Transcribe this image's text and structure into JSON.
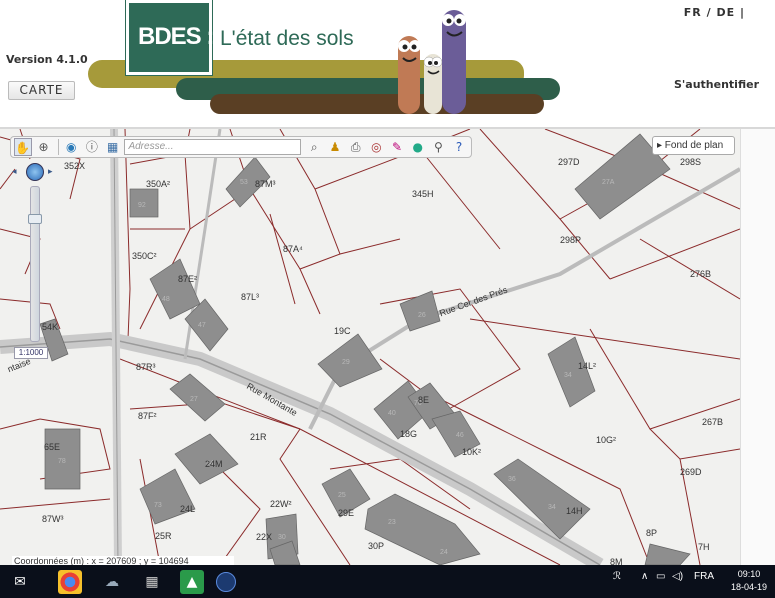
{
  "header": {
    "lang_fr": "FR",
    "lang_de": "DE",
    "version": "Version 4.1.0",
    "carte_button": "CARTE",
    "auth_link": "S'authentifier",
    "logo_bdes": "BDES :",
    "logo_title": "L'état des sols"
  },
  "toolbar": {
    "address_placeholder": "Adresse...",
    "fond_de_plan": "▸ Fond de plan"
  },
  "zoom": {
    "scale": "1:1000"
  },
  "coords": "Coordonnées (m) : x = 207609 ; y = 104694",
  "map": {
    "parcel_labels": [
      {
        "id": "352X",
        "text": "352X"
      },
      {
        "id": "350A2",
        "text": "350A²"
      },
      {
        "id": "87M3",
        "text": "87M³"
      },
      {
        "id": "345H",
        "text": "345H"
      },
      {
        "id": "297D",
        "text": "297D"
      },
      {
        "id": "298S",
        "text": "298S"
      },
      {
        "id": "350C2",
        "text": "350C²"
      },
      {
        "id": "87A4",
        "text": "87A⁴"
      },
      {
        "id": "298P",
        "text": "298P"
      },
      {
        "id": "276B",
        "text": "276B"
      },
      {
        "id": "87E2",
        "text": "87E²"
      },
      {
        "id": "87L3",
        "text": "87L³"
      },
      {
        "id": "19C",
        "text": "19C"
      },
      {
        "id": "54K",
        "text": "54K"
      },
      {
        "id": "87R3",
        "text": "87R³"
      },
      {
        "id": "87F2",
        "text": "87F²"
      },
      {
        "id": "21R",
        "text": "21R"
      },
      {
        "id": "8E",
        "text": "8E"
      },
      {
        "id": "18G",
        "text": "18G"
      },
      {
        "id": "10K2",
        "text": "10K²"
      },
      {
        "id": "10G2",
        "text": "10G²"
      },
      {
        "id": "267B",
        "text": "267B"
      },
      {
        "id": "269D",
        "text": "269D"
      },
      {
        "id": "65E",
        "text": "65E"
      },
      {
        "id": "24M",
        "text": "24M"
      },
      {
        "id": "24L",
        "text": "24L"
      },
      {
        "id": "87W3",
        "text": "87W³"
      },
      {
        "id": "22W2",
        "text": "22W²"
      },
      {
        "id": "22X",
        "text": "22X"
      },
      {
        "id": "29E",
        "text": "29E"
      },
      {
        "id": "30P",
        "text": "30P"
      },
      {
        "id": "25R",
        "text": "25R"
      },
      {
        "id": "14H",
        "text": "14H"
      },
      {
        "id": "8P",
        "text": "8P"
      },
      {
        "id": "7H",
        "text": "7H"
      },
      {
        "id": "8M",
        "text": "8M"
      },
      {
        "id": "14L2",
        "text": "14L²"
      }
    ],
    "street_montante": "Rue Montante",
    "street_cerdespres": "Rue Cer des Prés",
    "street_left": "ntaise"
  },
  "taskbar": {
    "lang": "FRA",
    "time": "09:10",
    "date": "18-04-19"
  },
  "colors": {
    "logo_green": "#2e6a57",
    "band_olive": "#a69a3a",
    "band_brown": "#5a3f24",
    "parcel_line": "#8b2b2b",
    "building_fill": "#8e8e8e",
    "map_bg": "#f1f1ef"
  }
}
